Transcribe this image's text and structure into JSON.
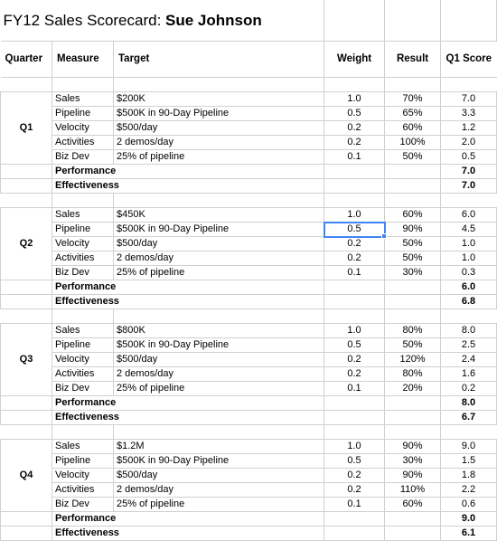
{
  "title": {
    "prefix": "FY12 Sales Scorecard: ",
    "name": "Sue Johnson"
  },
  "columns": {
    "quarter": "Quarter",
    "measure": "Measure",
    "target": "Target",
    "weight": "Weight",
    "result": "Result",
    "score": "Q1 Score"
  },
  "summary_labels": {
    "performance": "Performance",
    "effectiveness": "Effectiveness"
  },
  "selection": {
    "cell_value": "0.5",
    "quarter": "Q2",
    "measure": "Pipeline",
    "column": "Weight",
    "border_color": "#4285f4"
  },
  "quarters": [
    {
      "label": "Q1",
      "rows": [
        {
          "measure": "Sales",
          "target": "$200K",
          "weight": "1.0",
          "result": "70%",
          "score": "7.0"
        },
        {
          "measure": "Pipeline",
          "target": "$500K in 90-Day Pipeline",
          "weight": "0.5",
          "result": "65%",
          "score": "3.3"
        },
        {
          "measure": "Velocity",
          "target": "$500/day",
          "weight": "0.2",
          "result": "60%",
          "score": "1.2"
        },
        {
          "measure": "Activities",
          "target": "2 demos/day",
          "weight": "0.2",
          "result": "100%",
          "score": "2.0"
        },
        {
          "measure": "Biz Dev",
          "target": "25% of pipeline",
          "weight": "0.1",
          "result": "50%",
          "score": "0.5"
        }
      ],
      "performance": "7.0",
      "effectiveness": "7.0"
    },
    {
      "label": "Q2",
      "rows": [
        {
          "measure": "Sales",
          "target": "$450K",
          "weight": "1.0",
          "result": "60%",
          "score": "6.0"
        },
        {
          "measure": "Pipeline",
          "target": "$500K in 90-Day Pipeline",
          "weight": "0.5",
          "result": "90%",
          "score": "4.5"
        },
        {
          "measure": "Velocity",
          "target": "$500/day",
          "weight": "0.2",
          "result": "50%",
          "score": "1.0"
        },
        {
          "measure": "Activities",
          "target": "2 demos/day",
          "weight": "0.2",
          "result": "50%",
          "score": "1.0"
        },
        {
          "measure": "Biz Dev",
          "target": "25% of pipeline",
          "weight": "0.1",
          "result": "30%",
          "score": "0.3"
        }
      ],
      "performance": "6.0",
      "effectiveness": "6.8"
    },
    {
      "label": "Q3",
      "rows": [
        {
          "measure": "Sales",
          "target": "$800K",
          "weight": "1.0",
          "result": "80%",
          "score": "8.0"
        },
        {
          "measure": "Pipeline",
          "target": "$500K in 90-Day Pipeline",
          "weight": "0.5",
          "result": "50%",
          "score": "2.5"
        },
        {
          "measure": "Velocity",
          "target": "$500/day",
          "weight": "0.2",
          "result": "120%",
          "score": "2.4"
        },
        {
          "measure": "Activities",
          "target": "2 demos/day",
          "weight": "0.2",
          "result": "80%",
          "score": "1.6"
        },
        {
          "measure": "Biz Dev",
          "target": "25% of pipeline",
          "weight": "0.1",
          "result": "20%",
          "score": "0.2"
        }
      ],
      "performance": "8.0",
      "effectiveness": "6.7"
    },
    {
      "label": "Q4",
      "rows": [
        {
          "measure": "Sales",
          "target": "$1.2M",
          "weight": "1.0",
          "result": "90%",
          "score": "9.0"
        },
        {
          "measure": "Pipeline",
          "target": "$500K in 90-Day Pipeline",
          "weight": "0.5",
          "result": "30%",
          "score": "1.5"
        },
        {
          "measure": "Velocity",
          "target": "$500/day",
          "weight": "0.2",
          "result": "90%",
          "score": "1.8"
        },
        {
          "measure": "Activities",
          "target": "2 demos/day",
          "weight": "0.2",
          "result": "110%",
          "score": "2.2"
        },
        {
          "measure": "Biz Dev",
          "target": "25% of pipeline",
          "weight": "0.1",
          "result": "60%",
          "score": "0.6"
        }
      ],
      "performance": "9.0",
      "effectiveness": "6.1"
    }
  ]
}
